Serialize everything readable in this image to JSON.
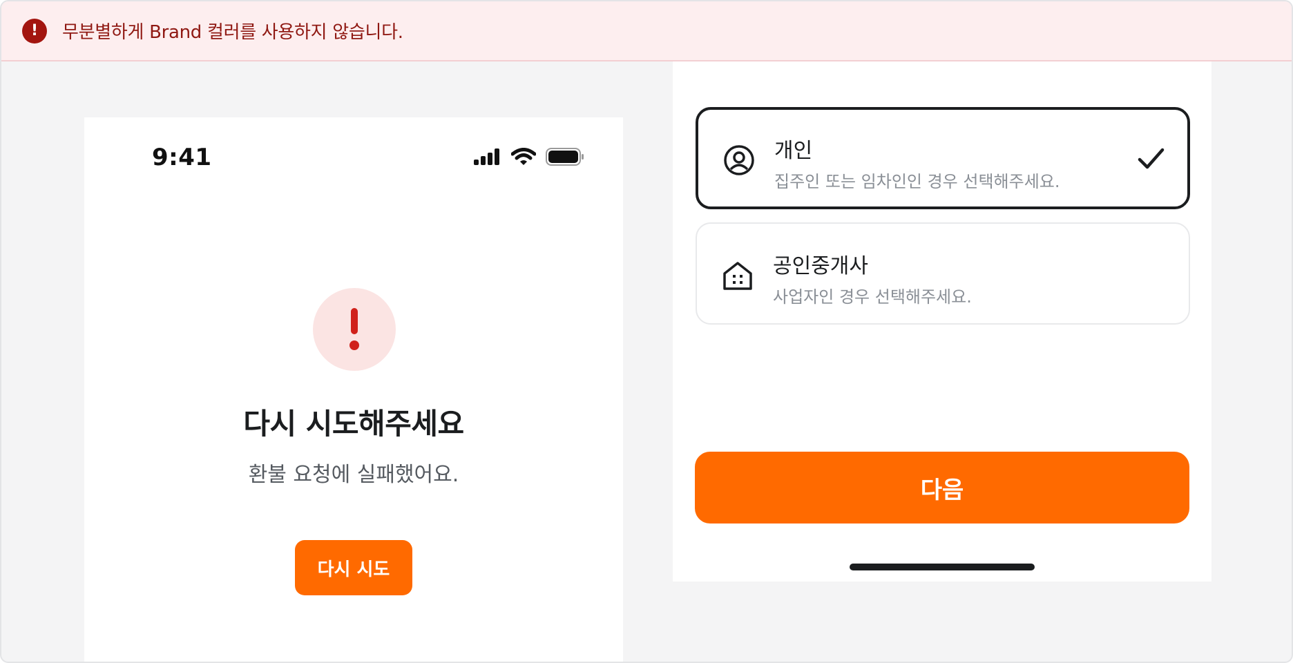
{
  "banner": {
    "icon": "exclamation-icon",
    "message": "무분별하게 Brand 컬러를 사용하지 않습니다."
  },
  "left_screen": {
    "status_bar": {
      "time": "9:41",
      "icons": [
        "cellular-signal-icon",
        "wifi-icon",
        "battery-icon"
      ]
    },
    "error_icon": "exclamation-icon",
    "title": "다시 시도해주세요",
    "description": "환불 요청에 실패했어요.",
    "retry_button_label": "다시 시도"
  },
  "right_screen": {
    "options": [
      {
        "icon": "user-circle-icon",
        "title": "개인",
        "description": "집주인 또는 임차인인 경우 선택해주세요.",
        "selected": true
      },
      {
        "icon": "building-icon",
        "title": "공인중개사",
        "description": "사업자인 경우 선택해주세요.",
        "selected": false
      }
    ],
    "next_button_label": "다음"
  },
  "colors": {
    "brand": "#FF6A00",
    "error": "#D0211B",
    "banner_bg": "#FDEEEF",
    "banner_text": "#8F1812"
  }
}
